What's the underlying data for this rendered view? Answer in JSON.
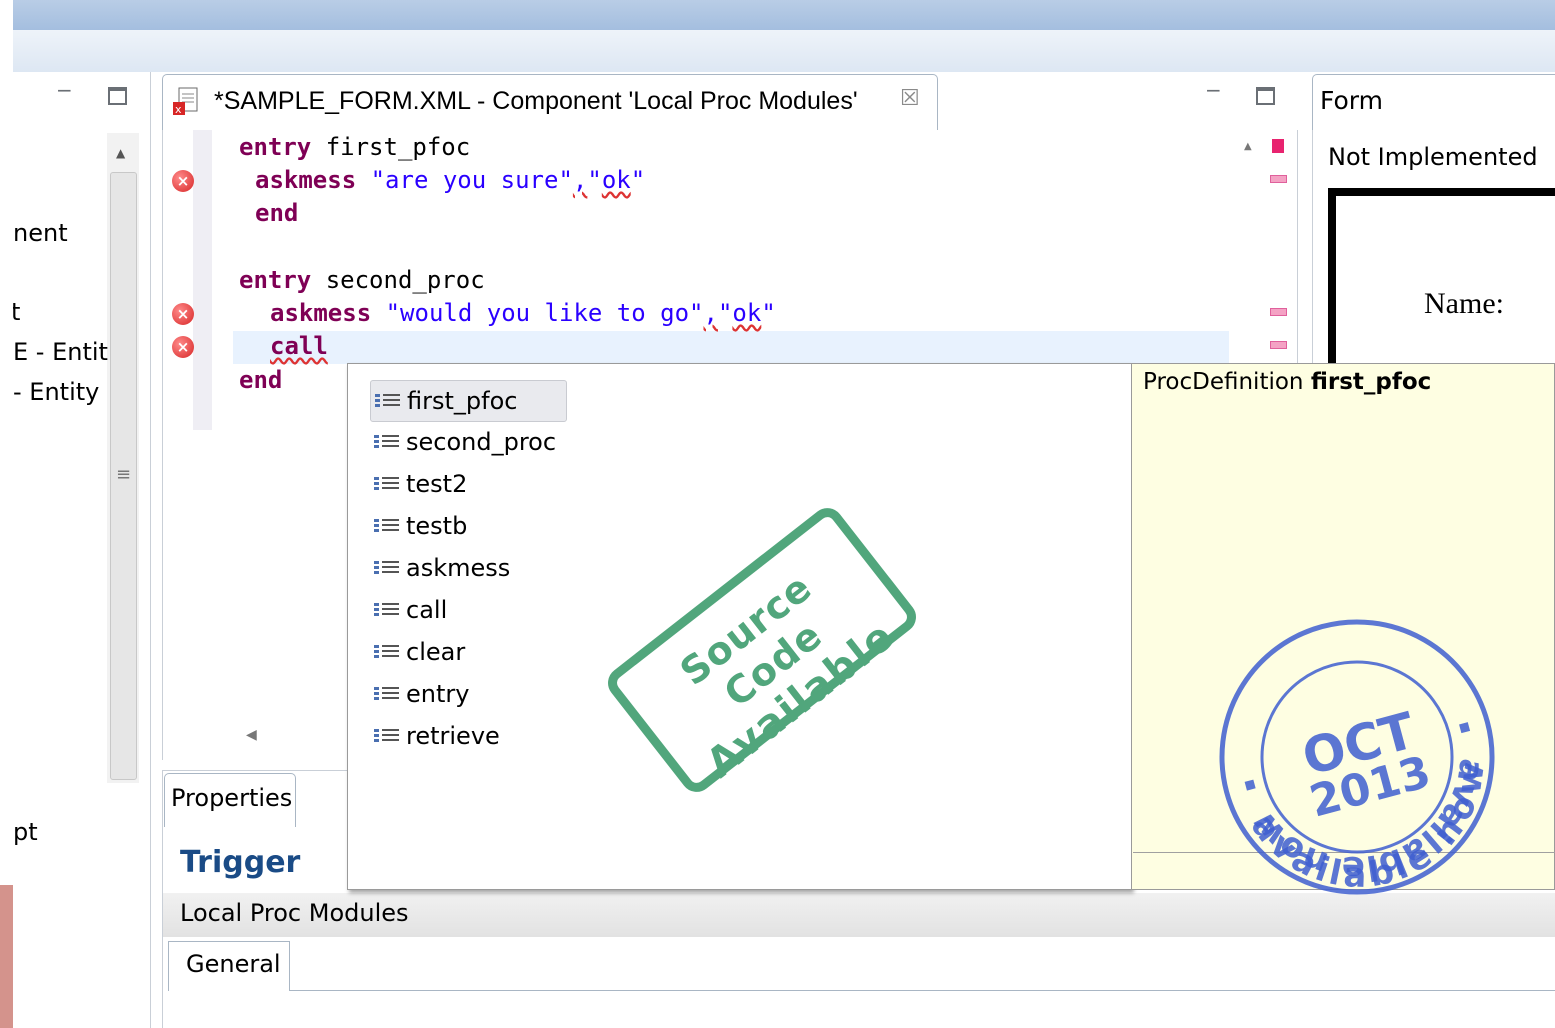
{
  "left_panel": {
    "items": [
      "nent",
      "t",
      "E - Entit",
      "- Entity",
      "pt"
    ]
  },
  "editor": {
    "tab_title": "*SAMPLE_FORM.XML - Component 'Local Proc Modules'",
    "code": {
      "l1_kw": "entry",
      "l1_name": " first_pfoc",
      "l2_kw": "askmess",
      "l2_s1": "\"are you sure\"",
      "l2_comma": ",",
      "l2_s2a": "\"",
      "l2_s2b": "ok",
      "l2_s2c": "\"",
      "l3_kw": "end",
      "l5_kw": "entry",
      "l5_name": " second_proc",
      "l6_kw": "askmess",
      "l6_s1": "\"would you like to go\"",
      "l6_comma": ",",
      "l6_s2a": "\"",
      "l6_s2b": "ok",
      "l6_s2c": "\"",
      "l7_kw": "call",
      "l8_kw": "end"
    }
  },
  "form_view": {
    "tab_label": "Form",
    "status": "Not Implemented",
    "name_label": "Name:"
  },
  "properties": {
    "tab_label": "Properties",
    "title": "Trigger",
    "subtitle": "Local Proc Modules",
    "sub_tab": "General"
  },
  "completion": {
    "items": [
      "first_pfoc",
      "second_proc",
      "test2",
      "testb",
      "askmess",
      "call",
      "clear",
      "entry",
      "retrieve"
    ]
  },
  "info_popup": {
    "prefix": "ProcDefinition ",
    "name": "first_pfoc"
  },
  "stamps": {
    "green_line1": "Source Code",
    "green_line2": "Available",
    "blue_top": "available now",
    "blue_month": "OCT",
    "blue_year": "2013",
    "blue_bottom": "available now"
  },
  "colors": {
    "keyword": "#7f0055",
    "string": "#2a00ff",
    "title_blue": "#1a4b86",
    "error_red": "#d72626",
    "stamp_green": "#3a9a6a",
    "stamp_blue": "#3f5fd0",
    "info_bg": "#fefee2"
  },
  "icons": {
    "error": "error-icon",
    "completion": "proc-list-icon",
    "xml_file": "xml-file-icon",
    "close": "close-icon",
    "minimize": "minimize-icon",
    "maximize": "maximize-icon"
  }
}
